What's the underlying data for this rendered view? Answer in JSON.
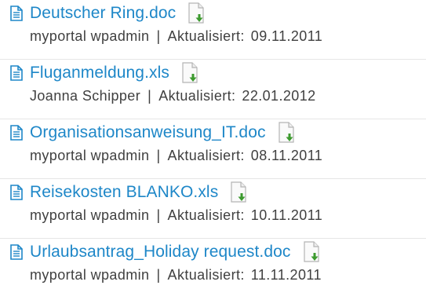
{
  "separator": "|",
  "updated_label": "Aktualisiert:",
  "icons": {
    "file": "document-icon",
    "download": "download-icon",
    "accent_color": "#1e87c8",
    "download_arrow_color": "#3c9a2e"
  },
  "documents": [
    {
      "title": "Deutscher Ring.doc",
      "author": "myportal wpadmin",
      "date": "09.11.2011"
    },
    {
      "title": "Fluganmeldung.xls",
      "author": "Joanna Schipper",
      "date": "22.01.2012"
    },
    {
      "title": "Organisationsanweisung_IT.doc",
      "author": "myportal wpadmin",
      "date": "08.11.2011"
    },
    {
      "title": "Reisekosten BLANKO.xls",
      "author": "myportal wpadmin",
      "date": "10.11.2011"
    },
    {
      "title": "Urlaubsantrag_Holiday request.doc",
      "author": "myportal wpadmin",
      "date": "11.11.2011"
    }
  ]
}
